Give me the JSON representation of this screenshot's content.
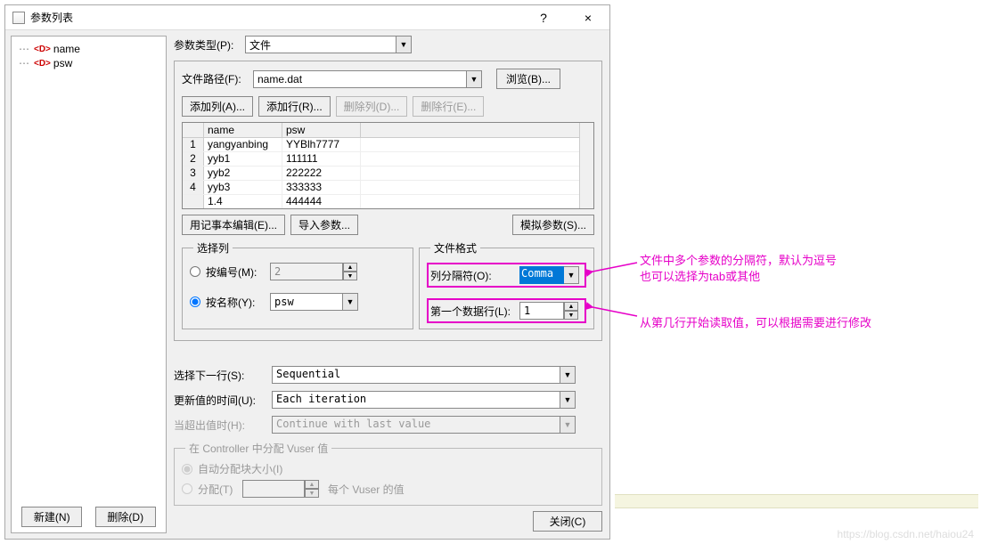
{
  "window": {
    "title": "参数列表",
    "help": "?",
    "close": "×"
  },
  "tree": {
    "items": [
      {
        "name": "name"
      },
      {
        "name": "psw"
      }
    ]
  },
  "sidebar_buttons": {
    "new": "新建(N)",
    "delete": "删除(D)"
  },
  "param_type": {
    "label": "参数类型(P):",
    "value": "文件"
  },
  "file_path": {
    "label": "文件路径(F):",
    "value": "name.dat",
    "browse": "浏览(B)..."
  },
  "table_buttons": {
    "add_col": "添加列(A)...",
    "add_row": "添加行(R)...",
    "del_col": "删除列(D)...",
    "del_row": "删除行(E)..."
  },
  "table": {
    "headers": {
      "name": "name",
      "psw": "psw"
    },
    "rows": [
      {
        "n": "1",
        "name": "yangyanbing",
        "psw": "YYBlh7777"
      },
      {
        "n": "2",
        "name": "yyb1",
        "psw": "111111"
      },
      {
        "n": "3",
        "name": "yyb2",
        "psw": "222222"
      },
      {
        "n": "4",
        "name": "yyb3",
        "psw": "333333"
      },
      {
        "n": "",
        "name": "  1.4",
        "psw": "444444"
      }
    ]
  },
  "below_table": {
    "notepad": "用记事本编辑(E)...",
    "import": "导入参数...",
    "simulate": "模拟参数(S)..."
  },
  "select_col": {
    "legend": "选择列",
    "by_number": "按编号(M):",
    "by_number_val": "2",
    "by_name": "按名称(Y):",
    "by_name_val": "psw"
  },
  "file_format": {
    "legend": "文件格式",
    "delimiter_label": "列分隔符(O):",
    "delimiter_value": "Comma",
    "first_row_label": "第一个数据行(L):",
    "first_row_value": "1"
  },
  "next_row": {
    "label": "选择下一行(S):",
    "value": "Sequential"
  },
  "update_time": {
    "label": "更新值的时间(U):",
    "value": "Each iteration"
  },
  "out_of_values": {
    "label": "当超出值时(H):",
    "value": "Continue with last value"
  },
  "vuser": {
    "legend": "在 Controller 中分配 Vuser 值",
    "auto": "自动分配块大小(I)",
    "manual": "分配(T)",
    "suffix": "每个 Vuser 的值"
  },
  "close_btn": "关闭(C)",
  "annotations": {
    "delim1": "文件中多个参数的分隔符，默认为逗号",
    "delim2": "也可以选择为tab或其他",
    "firstrow": "从第几行开始读取值，可以根据需要进行修改"
  },
  "watermark": "https://blog.csdn.net/haiou24",
  "chart_data": {
    "type": "table",
    "columns": [
      "name",
      "psw"
    ],
    "rows": [
      [
        "yangyanbing",
        "YYBlh7777"
      ],
      [
        "yyb1",
        "111111"
      ],
      [
        "yyb2",
        "222222"
      ],
      [
        "yyb3",
        "333333"
      ]
    ]
  }
}
